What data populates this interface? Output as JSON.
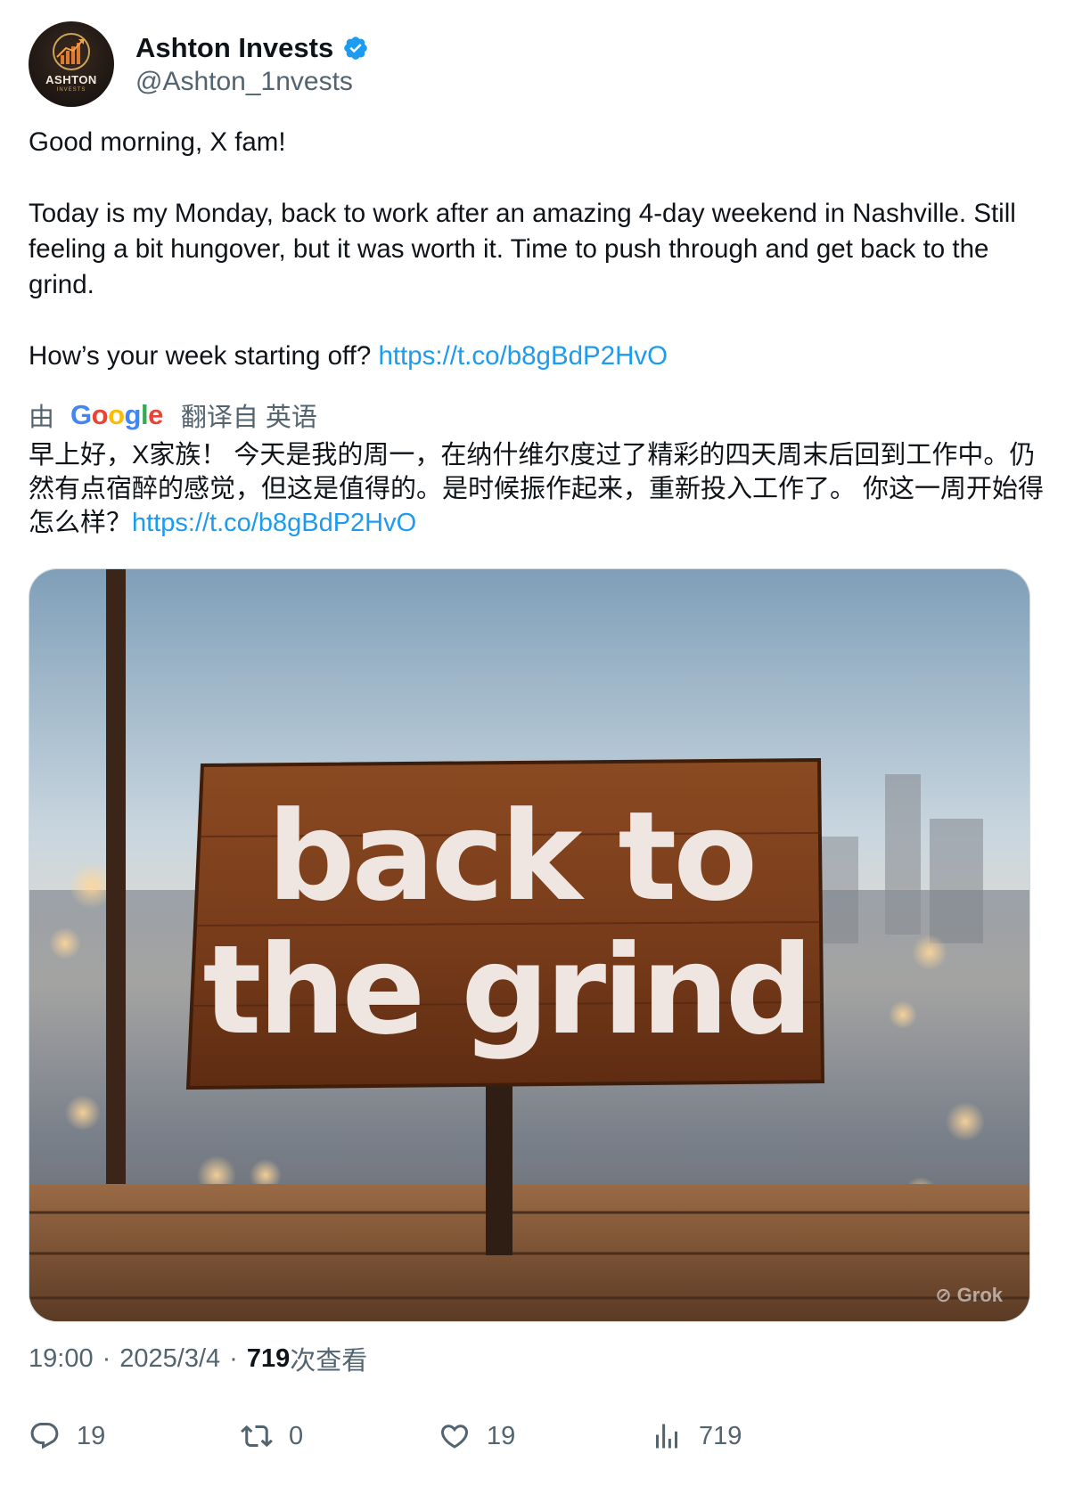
{
  "author": {
    "display_name": "Ashton Invests",
    "handle": "@Ashton_1nvests",
    "avatar_text": "ASHTON",
    "avatar_subtext": "INVESTS",
    "verified": true,
    "verified_color": "#1d9bf0"
  },
  "tweet": {
    "text": "Good morning, X fam!\n\nToday is my Monday, back to work after an amazing 4-day weekend in Nashville. Still feeling a bit hungover, but it was worth it. Time to push through and get back to the grind.\n\nHow’s your week starting off? ",
    "link": "https://t.co/b8gBdP2HvO"
  },
  "translation": {
    "prefix": "由",
    "provider_letters": [
      "G",
      "o",
      "o",
      "g",
      "l",
      "e"
    ],
    "suffix": "翻译自 英语",
    "text": "早上好，X家族！ 今天是我的周一，在纳什维尔度过了精彩的四天周末后回到工作中。仍然有点宿醉的感觉，但这是值得的。是时候振作起来，重新投入工作了。 你这一周开始得怎么样？",
    "link": "https://t.co/b8gBdP2HvO"
  },
  "media": {
    "sign_line1": "back to",
    "sign_line2": "the grind",
    "watermark": "Grok"
  },
  "meta": {
    "time": "19:00",
    "date": "2025/3/4",
    "views_count": "719",
    "views_label": "次查看"
  },
  "actions": {
    "replies": "19",
    "reposts": "0",
    "likes": "19",
    "views": "719"
  },
  "colors": {
    "link": "#1d9bf0",
    "secondary_text": "#536471",
    "primary_text": "#0f1419"
  }
}
